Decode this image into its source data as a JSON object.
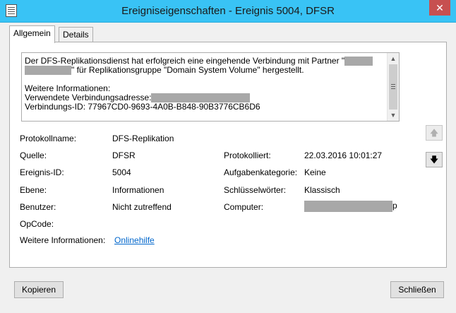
{
  "window": {
    "title": "Ereigniseigenschaften - Ereignis 5004, DFSR",
    "close_label": "✕"
  },
  "tabs": [
    {
      "label": "Allgemein",
      "active": true
    },
    {
      "label": "Details",
      "active": false
    }
  ],
  "description": {
    "line1_pre": "Der DFS-Replikationsdienst hat erfolgreich eine eingehende Verbindung mit Partner \"",
    "line2_post": "\" für Replikationsgruppe \"Domain System Volume\" hergestellt.",
    "line3": "Weitere Informationen:",
    "line4": "Verwendete Verbindungsadresse:",
    "line5": "Verbindungs-ID: 77967CD0-9693-4A0B-B848-90B3776CB6D6"
  },
  "fields": {
    "protokollname_label": "Protokollname:",
    "protokollname_value": "DFS-Replikation",
    "quelle_label": "Quelle:",
    "quelle_value": "DFSR",
    "protokolliert_label": "Protokolliert:",
    "protokolliert_value": "22.03.2016 10:01:27",
    "ereignis_label": "Ereignis-ID:",
    "ereignis_value": "5004",
    "aufgabe_label": "Aufgabenkategorie:",
    "aufgabe_value": "Keine",
    "ebene_label": "Ebene:",
    "ebene_value": "Informationen",
    "schluessel_label": "Schlüsselwörter:",
    "schluessel_value": "Klassisch",
    "benutzer_label": "Benutzer:",
    "benutzer_value": "Nicht zutreffend",
    "computer_label": "Computer:",
    "computer_suffix": "p",
    "opcode_label": "OpCode:",
    "weitere_label": "Weitere Informationen:",
    "weitere_link": "Onlinehilfe"
  },
  "buttons": {
    "copy_label": "Kopieren",
    "close_label": "Schließen"
  },
  "icons": {
    "window_icon": "event-log-icon",
    "nav_up": "arrow-up-icon",
    "nav_down": "arrow-down-icon"
  }
}
